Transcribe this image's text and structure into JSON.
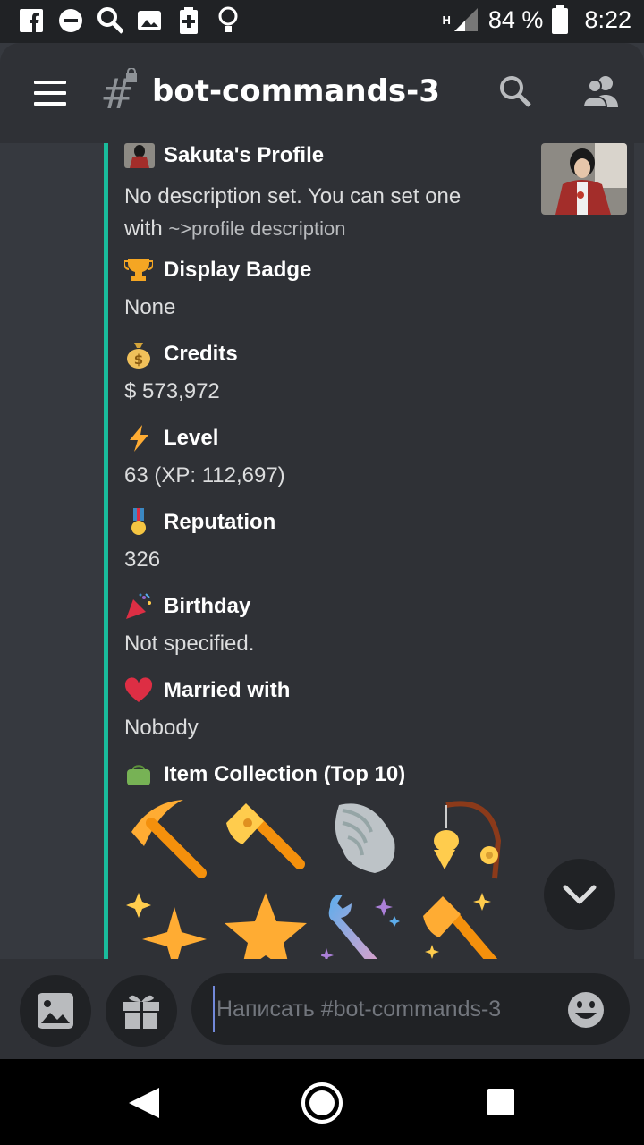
{
  "status": {
    "battery": "84 %",
    "time": "8:22",
    "network": "H"
  },
  "header": {
    "channel": "bot-commands-3"
  },
  "embed": {
    "author": "Sakuta's Profile",
    "description_line1": "No description set. You can set one",
    "description_with": "with",
    "description_code": "~>profile description",
    "fields": [
      {
        "name": "Display Badge",
        "value": "None",
        "emoji": "trophy-icon"
      },
      {
        "name": "Credits",
        "value": "$ 573,972",
        "emoji": "money-bag-icon"
      },
      {
        "name": "Level",
        "value": "63 (XP: 112,697)",
        "emoji": "lightning-icon"
      },
      {
        "name": "Reputation",
        "value": "326",
        "emoji": "medal-icon"
      },
      {
        "name": "Birthday",
        "value": "Not specified.",
        "emoji": "party-popper-icon"
      },
      {
        "name": "Married with",
        "value": "Nobody",
        "emoji": "heart-icon"
      },
      {
        "name": "Item Collection (Top 10)",
        "value": "",
        "emoji": "green-bag-icon"
      }
    ],
    "items": [
      "pickaxe-icon",
      "axe-icon",
      "shell-icon",
      "fishing-rod-icon",
      "sparkle-icon",
      "star-icon",
      "sparkle-wrench-icon",
      "sparkle-axe-icon"
    ]
  },
  "composer": {
    "placeholder": "Написать #bot-commands-3"
  },
  "colors": {
    "accent": "#1abc9c",
    "background": "#36393f",
    "header": "#2f3136"
  }
}
